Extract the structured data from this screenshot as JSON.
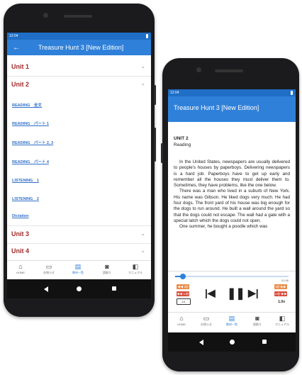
{
  "phone_left": {
    "status_time": "12:04",
    "app_title": "Treasure Hunt 3 [New Edition]",
    "units": [
      {
        "label": "Unit 1",
        "chevron": "chevron-down"
      },
      {
        "label": "Unit 2",
        "chevron": "chevron-up"
      },
      {
        "label": "Unit 3",
        "chevron": "chevron-down"
      },
      {
        "label": "Unit 4",
        "chevron": "chevron-down"
      }
    ],
    "unit2_items": [
      "READING　全文",
      "READING　パート 1",
      "READING　パート 2, 3",
      "READING　パート 4",
      "LISTENING　1",
      "LISTENING　2",
      "Dictation"
    ]
  },
  "phone_right": {
    "status_time": "12:04",
    "app_title": "Treasure Hunt 3 [New Edition]",
    "unit_heading": "UNIT 2",
    "section": "Reading",
    "paragraph_1": "In the United States, newspapers are usually delivered to people's houses by paperboys. Delivering newspapers is a hard job. Paperboys have to get up early and remember all the houses they must deliver them to. Sometimes, they have problems, like the one below.",
    "paragraph_2": "There was a man who lived in a suburb of New York. His name was Gibson. He liked dogs very much. He had four dogs. The front yard of his house was big enough for the dogs to run around. He built a wall around the yard so that the dogs could not escape. The wall had a gate with a special latch which the dogs could not open.",
    "paragraph_3": "One summer, he bought a poodle which was",
    "player": {
      "progress": 0.07,
      "time_display": "01:56",
      "skip_back_label": "◀◀ 5秒",
      "skip_back_10_label": "◀◀ 10秒",
      "skip_fwd_label": "5秒 ▶▶",
      "skip_fwd_10_label": "10秒 ▶▶",
      "repeat_label": "1/1",
      "speed": "1.0x"
    }
  },
  "tabs": [
    {
      "label": "HOME",
      "icon": "home-icon"
    },
    {
      "label": "お知らせ",
      "icon": "notice-icon"
    },
    {
      "label": "教材一覧",
      "icon": "materials-icon"
    },
    {
      "label": "読取り",
      "icon": "camera-icon"
    },
    {
      "label": "マニュアル",
      "icon": "manual-icon"
    }
  ],
  "colors": {
    "appbar": "#2f80d9",
    "statusbar": "#1f6fc7",
    "unit_label": "#a42b2b",
    "link": "#2f6fc9",
    "player_red": "#d94a3a",
    "player_orange": "#e98b4a"
  }
}
